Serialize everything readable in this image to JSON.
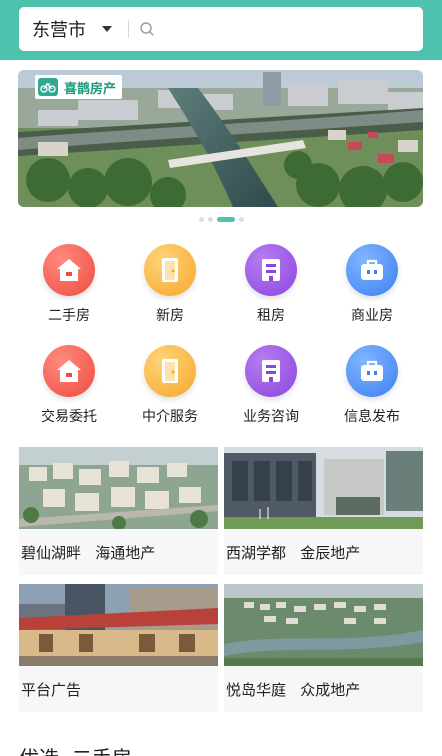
{
  "header": {
    "city": "东营市",
    "search_placeholder": "",
    "bg_color": "#4fc2ad"
  },
  "banner": {
    "brand": "喜鹊房产",
    "slide_count": 4,
    "active_slide": 3
  },
  "categories": [
    {
      "label": "二手房",
      "icon": "house-icon",
      "color": "red"
    },
    {
      "label": "新房",
      "icon": "door-icon",
      "color": "orange"
    },
    {
      "label": "租房",
      "icon": "building-icon",
      "color": "purple"
    },
    {
      "label": "商业房",
      "icon": "briefcase-icon",
      "color": "blue"
    },
    {
      "label": "交易委托",
      "icon": "house-icon",
      "color": "red"
    },
    {
      "label": "中介服务",
      "icon": "door-icon",
      "color": "orange"
    },
    {
      "label": "业务咨询",
      "icon": "building-icon",
      "color": "purple"
    },
    {
      "label": "信息发布",
      "icon": "briefcase-icon",
      "color": "blue"
    }
  ],
  "cards": [
    {
      "label": "碧仙湖畔   海通地产"
    },
    {
      "label": "西湖学都   金辰地产"
    },
    {
      "label": "平台广告"
    },
    {
      "label": "悦岛华庭   众成地产"
    }
  ],
  "section": {
    "title": "优选  二手房"
  }
}
